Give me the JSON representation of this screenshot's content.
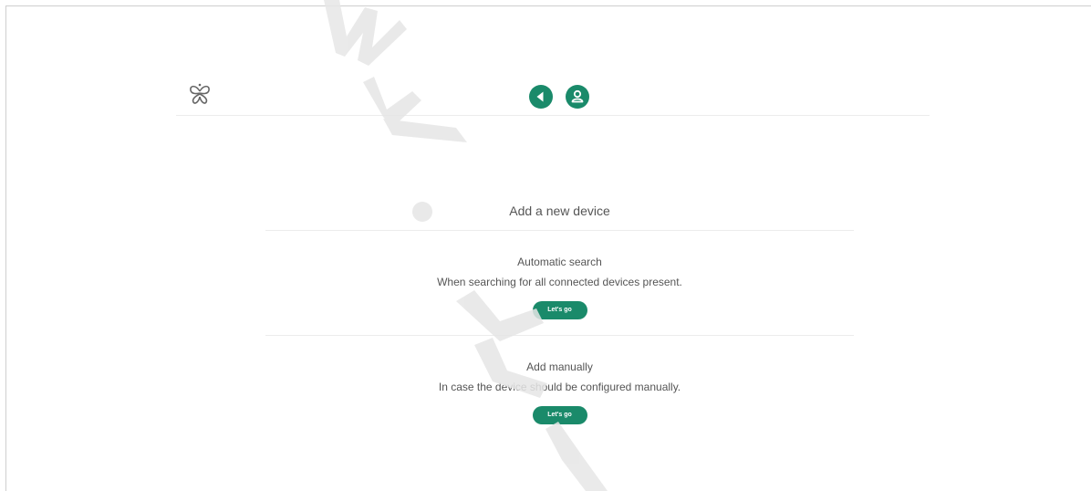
{
  "header": {
    "logo_icon": "butterfly-logo-icon",
    "back_icon": "back-arrow-icon",
    "account_icon": "user-icon",
    "accent_color": "#1a8a6a"
  },
  "main": {
    "title": "Add a new device",
    "options": [
      {
        "title": "Automatic search",
        "description": "When searching for all connected devices present.",
        "button_label": "Let's go"
      },
      {
        "title": "Add manually",
        "description": "In case the device should be configured manually.",
        "button_label": "Let's go"
      }
    ]
  }
}
